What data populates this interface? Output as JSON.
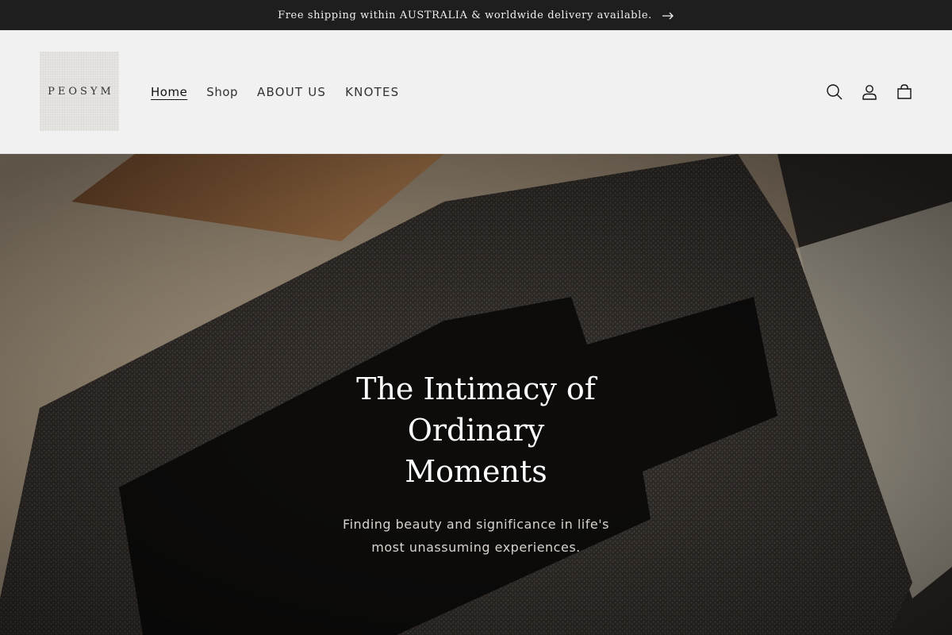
{
  "announcement": {
    "text": "Free shipping within AUSTRALIA & worldwide delivery available.",
    "arrow_icon": "arrow-right-icon"
  },
  "header": {
    "logo_text": "PEOSYM",
    "nav": [
      {
        "label": "Home",
        "active": true
      },
      {
        "label": "Shop",
        "active": false
      },
      {
        "label": "ABOUT US",
        "active": false
      },
      {
        "label": "KNOTES",
        "active": false
      }
    ],
    "icons": [
      "search-icon",
      "account-icon",
      "cart-icon"
    ]
  },
  "hero": {
    "title": "The Intimacy of Ordinary Moments",
    "subtitle": "Finding beauty and significance in life's most unassuming experiences."
  }
}
